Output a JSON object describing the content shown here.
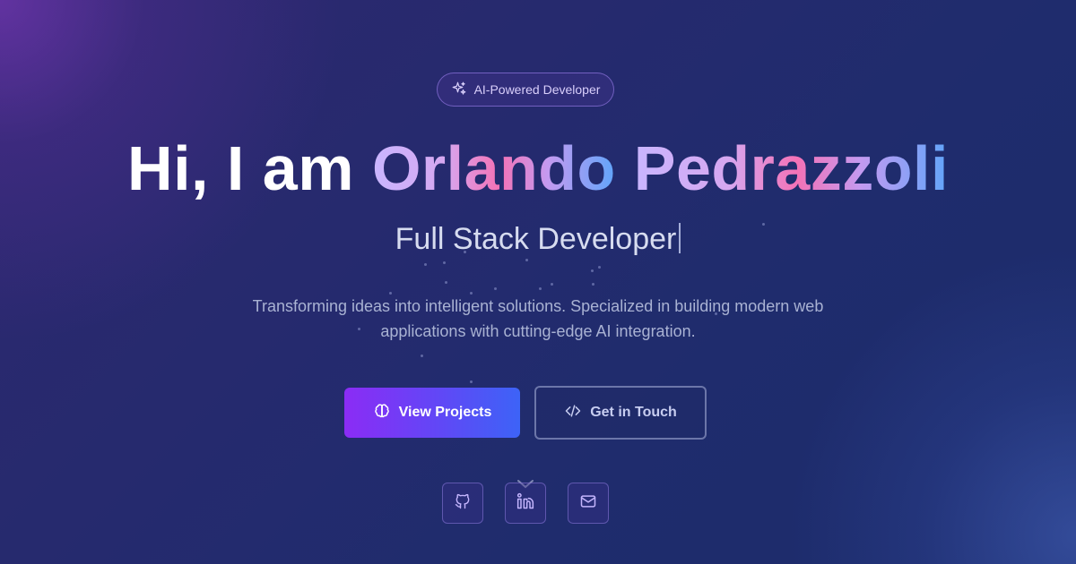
{
  "badge": {
    "label": "AI-Powered Developer",
    "icon": "sparkles-icon"
  },
  "headline": {
    "greeting": "Hi, I am ",
    "first_name": "Orlando",
    "last_name": "Pedrazzoli"
  },
  "subtitle": {
    "role": "Full Stack Developer"
  },
  "description": {
    "line1": "Transforming ideas into intelligent solutions. Specialized in building modern web",
    "line2": "applications with cutting-edge AI integration."
  },
  "buttons": {
    "primary": {
      "label": "View Projects",
      "icon": "brain-icon"
    },
    "secondary": {
      "label": "Get in Touch",
      "icon": "code-icon"
    }
  },
  "social": [
    {
      "name": "GitHub",
      "icon": "github-icon"
    },
    {
      "name": "LinkedIn",
      "icon": "linkedin-icon"
    },
    {
      "name": "Email",
      "icon": "mail-icon"
    }
  ],
  "colors": {
    "accent_purple": "#8b2cf5",
    "accent_blue": "#3d63f7",
    "name_gradient": [
      "#c9b6ff",
      "#f472b6",
      "#60a5fa"
    ],
    "background": "#1e2a6a"
  }
}
